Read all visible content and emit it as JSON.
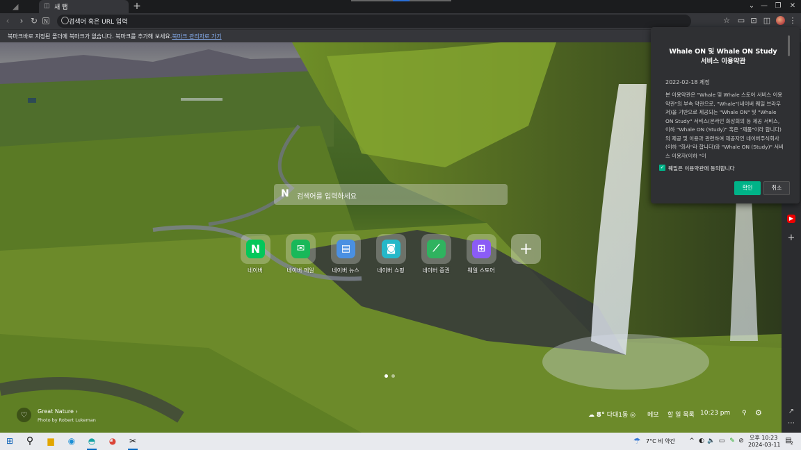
{
  "browser": {
    "tab_title": "새 탭",
    "new_tab_label": "+",
    "address_placeholder": "검색어 혹은 URL 입력",
    "window_controls": {
      "minimize": "—",
      "restore": "❐",
      "close": "✕",
      "dropdown": "⌄"
    }
  },
  "bookmark_bar": {
    "message": "북마크바로 지정된 폴더에 북마크가 없습니다. 북마크를 추가해 보세요.",
    "link_label": "북마크 관리자로 가기"
  },
  "page": {
    "search_logo": "N",
    "search_placeholder": "검색어를 입력하세요",
    "shortcuts": [
      {
        "label": "네이버",
        "icon": "naver-icon",
        "color": "#03c75a",
        "glyph": "N"
      },
      {
        "label": "네이버 메일",
        "icon": "naver-mail-icon",
        "color": "#19b859",
        "glyph": "✉"
      },
      {
        "label": "네이버 뉴스",
        "icon": "naver-news-icon",
        "color": "#4a90e2",
        "glyph": "▤"
      },
      {
        "label": "네이버 쇼핑",
        "icon": "naver-shopping-icon",
        "color": "#25b8c9",
        "glyph": "◙"
      },
      {
        "label": "네이버 증권",
        "icon": "naver-stock-icon",
        "color": "#2fb35f",
        "glyph": "⟋"
      },
      {
        "label": "웨일 스토어",
        "icon": "whale-store-icon",
        "color": "#8b5cf6",
        "glyph": "⊞"
      }
    ],
    "add_shortcut": "+",
    "photo_title": "Great Nature",
    "photo_credit": "Photo by Robert Lukeman",
    "weather_temp": "8°",
    "weather_location": "다대1동",
    "memo_label": "메모",
    "todo_label": "할 일 목록",
    "clock": "10:23 pm"
  },
  "terms_popup": {
    "title_line1": "Whale ON 및 Whale ON Study",
    "title_line2": "서비스 이용약관",
    "date": "2022-02-18 제정",
    "body": "본 이용약관은 \"Whale 및 Whale 스토어 서비스 이용약관\"의 부속 약관으로, \"Whale\"(네이버 웨일 브라우저)을 기반으로 제공되는 \"Whale ON\" 및 \"Whale ON Study\" 서비스(온라인 화상회의 등 제공 서비스, 이하 \"Whale ON (Study)\" 혹은 \"제품\"이라 합니다)의 제공 및 이용과 관련하여 제공자인 네이버주식회사(이하 \"회사\"라 합니다)와 \"Whale ON (Study)\" 서비스 이용자(이하 \"이",
    "checkbox_label": "웨일은 이용약관에 동의합니다",
    "ok_label": "확인",
    "cancel_label": "취소"
  },
  "taskbar": {
    "weather": "7°C  비 약간",
    "time": "오후 10:23",
    "date": "2024-03-11",
    "notification_count": "2"
  },
  "colors": {
    "accent_green": "#00b388",
    "link_blue": "#8ab4f8"
  }
}
